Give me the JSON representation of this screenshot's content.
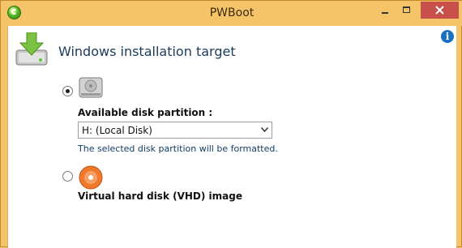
{
  "window": {
    "title": "PWBoot",
    "accent": "#f5c469",
    "close_color": "#c7504a"
  },
  "icons": {
    "app": "pwboot-app-icon",
    "info": "info-icon",
    "section": "hdd-download-icon",
    "disk": "hard-disk-icon",
    "vhd": "optical-disc-icon"
  },
  "section": {
    "title": "Windows installation target",
    "info_glyph": "i"
  },
  "options": {
    "disk": {
      "selected": true,
      "label": "Available disk partition :",
      "select_value": "H: (Local Disk)",
      "note": "The selected disk partition will be formatted."
    },
    "vhd": {
      "selected": false,
      "label": "Virtual hard disk (VHD) image"
    }
  }
}
